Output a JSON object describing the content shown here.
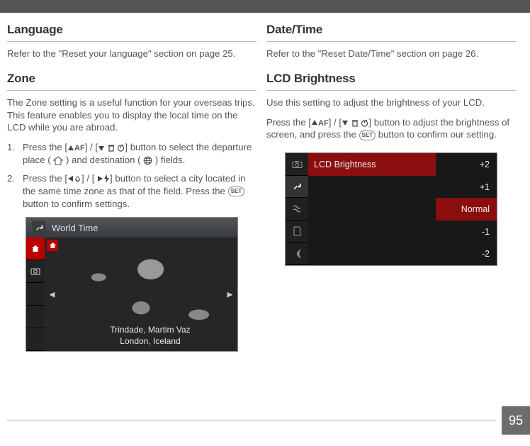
{
  "page_number": "95",
  "left": {
    "language": {
      "heading": "Language",
      "body": "Refer to the \"Reset your language\" section on page 25."
    },
    "zone": {
      "heading": "Zone",
      "intro": "The Zone setting is a useful function for your overseas trips. This feature enables you to display the local time on the LCD while you are abroad.",
      "step1_a": "Press the [",
      "step1_af": "AF",
      "step1_b": "] / [",
      "step1_c": "] button to select the departure place (",
      "step1_d": ") and destination (",
      "step1_e": ") fields.",
      "step2_a": "Press the [",
      "step2_b": "] / [",
      "step2_c": "] button to select a city located in the same time zone as that of the field. Press the",
      "step2_set": "SET",
      "step2_d": "button to confirm settings."
    },
    "world_time": {
      "title": "World Time",
      "caption_line1": "Trindade, Martim Vaz",
      "caption_line2": "London, Iceland"
    }
  },
  "right": {
    "datetime": {
      "heading": "Date/Time",
      "body": "Refer to the \"Reset Date/Time\" section on page 26."
    },
    "lcd": {
      "heading": "LCD Brightness",
      "intro": "Use this setting to adjust the brightness of your LCD.",
      "press_a": "Press the [",
      "press_af": "AF",
      "press_b": "] / [",
      "press_c": "] button to adjust the brightness of screen, and press the",
      "press_set": "SET",
      "press_d": "button to confirm our setting.",
      "menu_label": "LCD Brightness",
      "options": {
        "p2": "+2",
        "p1": "+1",
        "normal": "Normal",
        "m1": "-1",
        "m2": "-2"
      }
    }
  }
}
